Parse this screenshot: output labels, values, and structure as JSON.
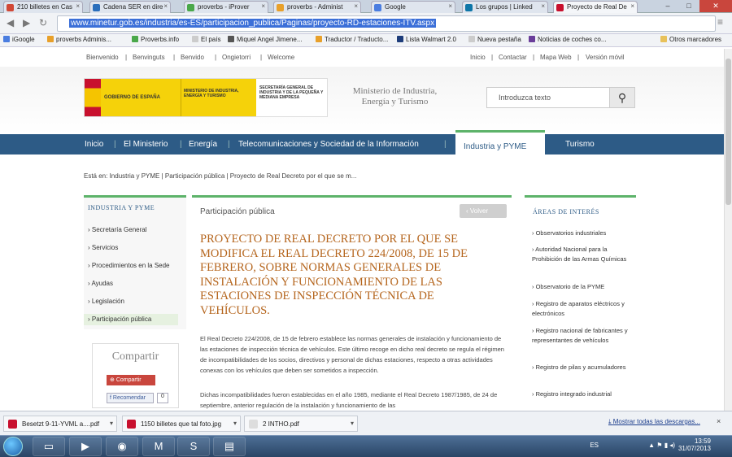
{
  "browser": {
    "tabs": [
      {
        "label": "210 billetes en Cas",
        "color": "#d14836"
      },
      {
        "label": "Cadena SER en dire",
        "color": "#2a6ebb"
      },
      {
        "label": "proverbs - iProver",
        "color": "#4aa84a"
      },
      {
        "label": "proverbs - Administ",
        "color": "#e8a02a"
      },
      {
        "label": "Google",
        "color": "#4a7de0"
      },
      {
        "label": "Los grupos | Linked",
        "color": "#0e76a8"
      },
      {
        "label": "Proyecto de Real De",
        "color": "#c8102e"
      }
    ],
    "window_controls": [
      "–",
      "□",
      "✕"
    ],
    "url": "www.minetur.gob.es/industria/es-ES/participacion_publica/Paginas/proyecto-RD-estaciones-ITV.aspx",
    "bookmarks": [
      "iGoogle",
      "proverbs Adminis...",
      "Proverbs.info",
      "El país",
      "Miquel Angel Jimene...",
      "Traductor / Traducto...",
      "Lista Walmart 2.0",
      "Nueva pestaña",
      "Noticias de coches co...",
      "Otros marcadores"
    ]
  },
  "site": {
    "utility_left": [
      "Bienvenido",
      "Benvinguts",
      "Benvido",
      "Ongietorri",
      "Welcome"
    ],
    "utility_right": [
      "Inicio",
      "Contactar",
      "Mapa Web",
      "Versión móvil"
    ],
    "logo_text": {
      "gobierno": "GOBIERNO DE ESPAÑA",
      "ministerio": "MINISTERIO DE INDUSTRIA, ENERGÍA Y TURISMO",
      "secretaria": "SECRETARÍA GENERAL DE INDUSTRIA Y DE LA PEQUEÑA Y MEDIANA EMPRESA"
    },
    "ministry_watermark": "Ministerio de Industria, Energía y Turismo",
    "search_placeholder": "Introduzca texto",
    "main_nav": [
      "Inicio",
      "El Ministerio",
      "Energía",
      "Telecomunicaciones y Sociedad de la Información",
      "Industria y PYME",
      "Turismo"
    ],
    "breadcrumb": "Está en: Industria y PYME  |  Participación pública  |  Proyecto de Real Decreto por el que se m...",
    "left_menu": {
      "heading": "INDUSTRIA Y PYME",
      "items": [
        "Secretaría General",
        "Servicios",
        "Procedimientos en la Sede",
        "Ayudas",
        "Legislación",
        "Participación pública"
      ]
    },
    "share": {
      "title": "Compartir",
      "button": "Compartir",
      "facebook": "Recomendar",
      "count": "0"
    },
    "main": {
      "section": "Participación pública",
      "back_button": "Volver",
      "title": "PROYECTO DE REAL DECRETO POR EL QUE SE MODIFICA EL REAL DECRETO 224/2008, DE 15 DE FEBRERO, SOBRE NORMAS GENERALES DE INSTALACIÓN Y FUNCIONAMIENTO DE LAS ESTACIONES DE INSPECCIÓN TÉCNICA DE VEHÍCULOS.",
      "paragraph1": "El Real Decreto 224/2008, de 15 de febrero establece las normas generales de instalación y funcionamiento de las estaciones de inspección técnica de vehículos. Este último recoge en dicho real decreto se regula el régimen de incompatibilidades de los socios, directivos y personal de dichas estaciones, respecto a otras actividades conexas con los vehículos que deben ser sometidos a inspección.",
      "paragraph2": "Dichas incompatibilidades fueron establecidas en el año 1985, mediante el Real Decreto 1987/1985, de 24 de septiembre, anterior regulación de la instalación y funcionamiento de las"
    },
    "right_menu": {
      "heading": "ÁREAS DE INTERÉS",
      "items": [
        "Observatorios industriales",
        "Autoridad Nacional para la Prohibición de las Armas Químicas",
        "Observatorio de la PYME",
        "Registro de aparatos eléctricos y electrónicos",
        "Registro nacional de fabricantes y representantes de vehículos",
        "Registro de pilas y acumuladores",
        "Registro integrado industrial"
      ]
    }
  },
  "downloads": {
    "items": [
      "Besetzt 9-11-YVML a....pdf",
      "1150 billetes que tal foto.jpg",
      "2 INTHO.pdf"
    ],
    "show_all": "Mostrar todas las descargas..."
  },
  "taskbar": {
    "lang": "ES",
    "time": "13:59",
    "date": "31/07/2013"
  }
}
